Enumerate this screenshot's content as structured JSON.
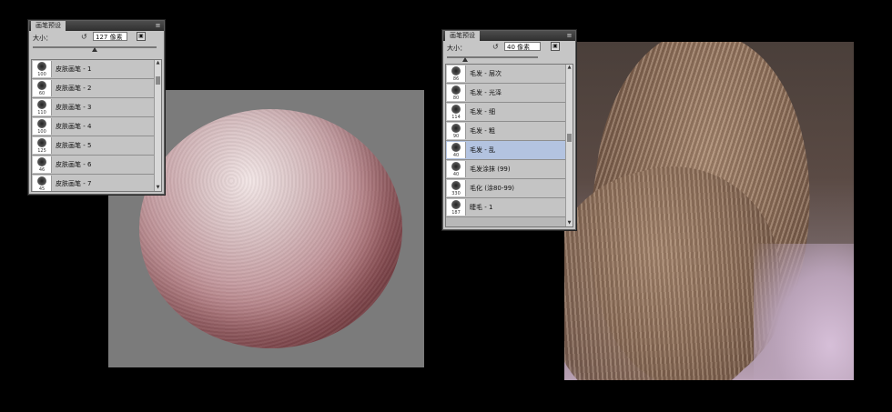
{
  "left_panel": {
    "tab_title": "画笔预设",
    "size_label": "大小：",
    "size_value": "127 像素",
    "slider_fraction": 0.5,
    "brushes": [
      {
        "num": "100",
        "name": "皮肤画笔 - 1"
      },
      {
        "num": "60",
        "name": "皮肤画笔 - 2"
      },
      {
        "num": "110",
        "name": "皮肤画笔 - 3"
      },
      {
        "num": "100",
        "name": "皮肤画笔 - 4"
      },
      {
        "num": "125",
        "name": "皮肤画笔 - 5"
      },
      {
        "num": "46",
        "name": "皮肤画笔 - 6"
      },
      {
        "num": "45",
        "name": "皮肤画笔 - 7"
      }
    ]
  },
  "right_panel": {
    "tab_title": "画笔预设",
    "size_label": "大小：",
    "size_value": "40 像素",
    "slider_fraction": 0.2,
    "brushes": [
      {
        "num": "86",
        "name": "毛发 - 层次"
      },
      {
        "num": "80",
        "name": "毛发 - 光泽"
      },
      {
        "num": "114",
        "name": "毛发 - 细"
      },
      {
        "num": "90",
        "name": "毛发 - 粗"
      },
      {
        "num": "40",
        "name": "毛发 - 乱",
        "selected": true
      },
      {
        "num": "40",
        "name": "毛发涂抹 (99)"
      },
      {
        "num": "330",
        "name": "毛化 (涂80-99)"
      },
      {
        "num": "187",
        "name": "睫毛 - 1"
      }
    ]
  },
  "icons": {
    "reset": "↺",
    "menu": "≡",
    "new_preset": "new-preset-icon"
  }
}
